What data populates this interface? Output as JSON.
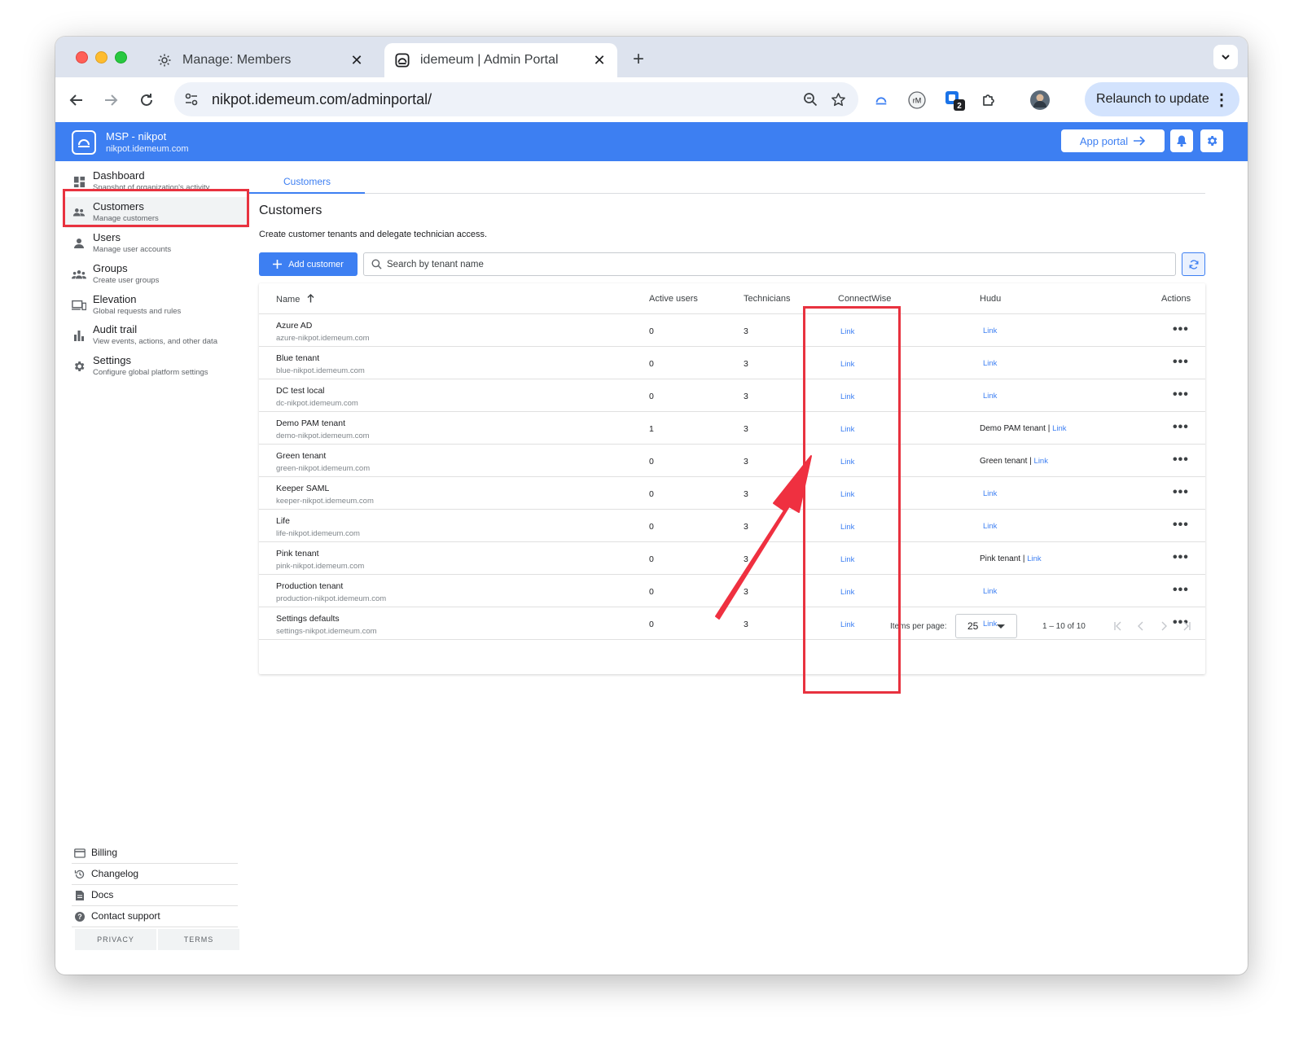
{
  "browser": {
    "tabs": [
      {
        "label": "Manage: Members"
      },
      {
        "label": "idemeum | Admin Portal"
      }
    ],
    "url": "nikpot.idemeum.com/adminportal/",
    "extension_badge": "2",
    "relaunch_label": "Relaunch to update"
  },
  "header": {
    "org_name": "MSP - nikpot",
    "org_domain": "nikpot.idemeum.com",
    "app_portal_label": "App portal"
  },
  "sidebar": {
    "items": [
      {
        "title": "Dashboard",
        "subtitle": "Snapshot of organization's activity"
      },
      {
        "title": "Customers",
        "subtitle": "Manage customers"
      },
      {
        "title": "Users",
        "subtitle": "Manage user accounts"
      },
      {
        "title": "Groups",
        "subtitle": "Create user groups"
      },
      {
        "title": "Elevation",
        "subtitle": "Global requests and rules"
      },
      {
        "title": "Audit trail",
        "subtitle": "View events, actions, and other data"
      },
      {
        "title": "Settings",
        "subtitle": "Configure global platform settings"
      }
    ],
    "footer_items": [
      {
        "label": "Billing"
      },
      {
        "label": "Changelog"
      },
      {
        "label": "Docs"
      },
      {
        "label": "Contact support"
      }
    ],
    "legal": {
      "privacy": "PRIVACY",
      "terms": "TERMS"
    }
  },
  "main": {
    "tab_label": "Customers",
    "title": "Customers",
    "description": "Create customer tenants and delegate technician access.",
    "add_button_label": "Add customer",
    "search_placeholder": "Search by tenant name",
    "columns": {
      "name": "Name",
      "active_users": "Active users",
      "technicians": "Technicians",
      "connectwise": "ConnectWise",
      "hudu": "Hudu",
      "actions": "Actions"
    },
    "link_label": "Link",
    "rows": [
      {
        "name": "Azure AD",
        "domain": "azure-nikpot.idemeum.com",
        "active_users": "0",
        "technicians": "3",
        "hudu_name": ""
      },
      {
        "name": "Blue tenant",
        "domain": "blue-nikpot.idemeum.com",
        "active_users": "0",
        "technicians": "3",
        "hudu_name": ""
      },
      {
        "name": "DC test local",
        "domain": "dc-nikpot.idemeum.com",
        "active_users": "0",
        "technicians": "3",
        "hudu_name": ""
      },
      {
        "name": "Demo PAM tenant",
        "domain": "demo-nikpot.idemeum.com",
        "active_users": "1",
        "technicians": "3",
        "hudu_name": "Demo PAM tenant |"
      },
      {
        "name": "Green tenant",
        "domain": "green-nikpot.idemeum.com",
        "active_users": "0",
        "technicians": "3",
        "hudu_name": "Green tenant |"
      },
      {
        "name": "Keeper SAML",
        "domain": "keeper-nikpot.idemeum.com",
        "active_users": "0",
        "technicians": "3",
        "hudu_name": ""
      },
      {
        "name": "Life",
        "domain": "life-nikpot.idemeum.com",
        "active_users": "0",
        "technicians": "3",
        "hudu_name": ""
      },
      {
        "name": "Pink tenant",
        "domain": "pink-nikpot.idemeum.com",
        "active_users": "0",
        "technicians": "3",
        "hudu_name": "Pink tenant |"
      },
      {
        "name": "Production tenant",
        "domain": "production-nikpot.idemeum.com",
        "active_users": "0",
        "technicians": "3",
        "hudu_name": ""
      },
      {
        "name": "Settings defaults",
        "domain": "settings-nikpot.idemeum.com",
        "active_users": "0",
        "technicians": "3",
        "hudu_name": ""
      }
    ],
    "pagination": {
      "items_per_page_label": "Items per page:",
      "items_per_page": "25",
      "range": "1 – 10 of 10"
    }
  },
  "colors": {
    "accent": "#3d7ff2",
    "annotation": "#e8323f"
  }
}
